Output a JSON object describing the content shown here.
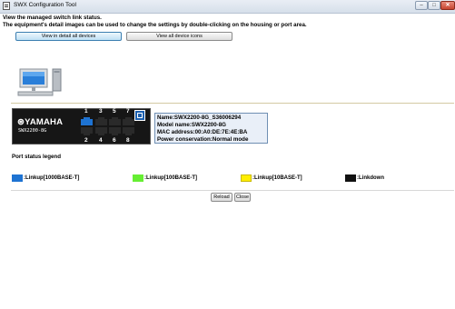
{
  "window": {
    "title": "SWX Configuration Tool"
  },
  "intro": {
    "line1": "View the managed switch link status.",
    "line2": "The equipment's detail images can be used to change the settings by double-clicking on the housing or port area."
  },
  "buttons": {
    "view_detail": "View in detail all devices",
    "view_icons": "View all device icons",
    "reload": "Reload",
    "close": "Close"
  },
  "device": {
    "brand": "⊛YAMAHA",
    "model_label": "SWX2200-8G",
    "top_port_numbers": [
      "1",
      "3",
      "5",
      "7"
    ],
    "bottom_port_numbers": [
      "2",
      "4",
      "6",
      "8"
    ],
    "ports_up": [
      1
    ],
    "info": {
      "name": "Name:SWX2200-8G_S36006294",
      "model_name": "Model name:SWX2200-8G",
      "mac": "MAC address:00:A0:DE:7E:4E:BA",
      "power": "Power conservation:Normal mode"
    }
  },
  "legend": {
    "title": "Port status legend",
    "items": [
      {
        "label": ":Linkup[1000BASE-T]",
        "color": "#1e73d2"
      },
      {
        "label": ":Linkup[100BASE-T]",
        "color": "#66ee33"
      },
      {
        "label": ":Linkup[10BASE-T]",
        "color": "#ffee00"
      },
      {
        "label": ":Linkdown",
        "color": "#111111"
      }
    ]
  },
  "colors": {
    "accent": "#3c7fb1",
    "info_bg": "#e9eff8"
  },
  "icons": {
    "app": "config-tool-icon",
    "computer": "computer-icon",
    "monitor": "monitor-icon"
  }
}
